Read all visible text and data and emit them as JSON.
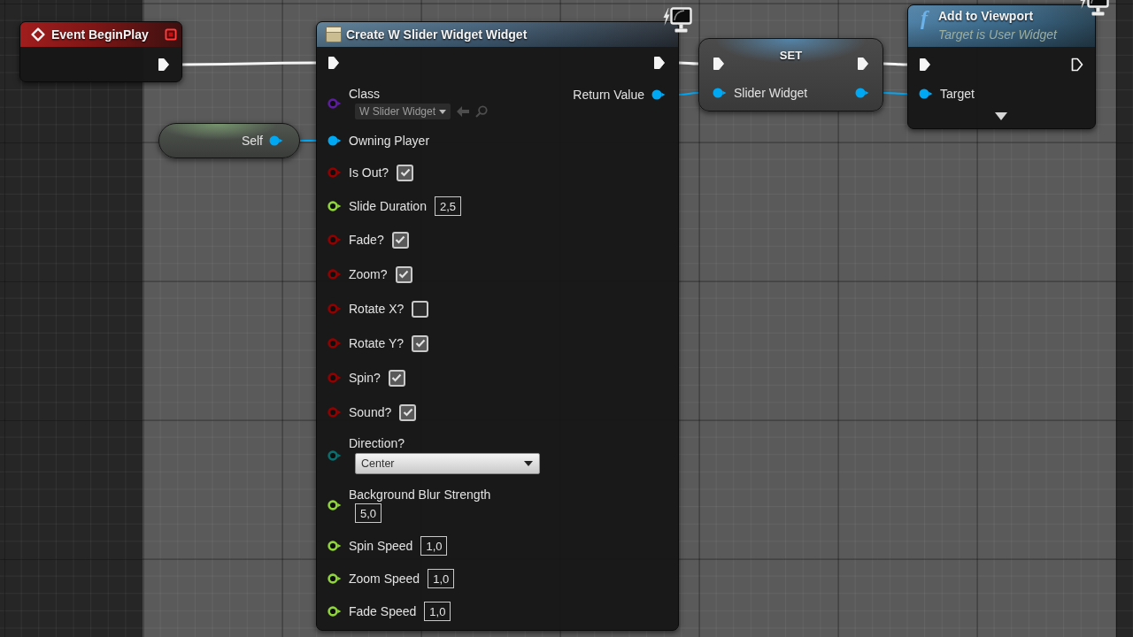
{
  "graph": {
    "nodes": [
      {
        "kind": "event",
        "title": "Event BeginPlay",
        "outputs": [
          {
            "kind": "delegate",
            "connected": false
          },
          {
            "kind": "exec",
            "connected": true
          }
        ]
      },
      {
        "kind": "self",
        "outputs": [
          {
            "kind": "object",
            "label": "Self",
            "connected": true
          }
        ]
      },
      {
        "kind": "create_widget",
        "title": "Create W Slider Widget Widget",
        "client_only": true,
        "inputs": [
          {
            "kind": "exec",
            "connected": true
          },
          {
            "kind": "class",
            "label": "Class",
            "connected": false,
            "value": "W Slider Widget"
          },
          {
            "kind": "object",
            "label": "Owning Player",
            "connected": true
          },
          {
            "kind": "bool",
            "label": "Is Out?",
            "connected": false,
            "checked": true
          },
          {
            "kind": "float",
            "label": "Slide Duration",
            "connected": false,
            "value": "2,5"
          },
          {
            "kind": "bool",
            "label": "Fade?",
            "connected": false,
            "checked": true
          },
          {
            "kind": "bool",
            "label": "Zoom?",
            "connected": false,
            "checked": true
          },
          {
            "kind": "bool",
            "label": "Rotate X?",
            "connected": false,
            "checked": false
          },
          {
            "kind": "bool",
            "label": "Rotate Y?",
            "connected": false,
            "checked": true
          },
          {
            "kind": "bool",
            "label": "Spin?",
            "connected": false,
            "checked": true
          },
          {
            "kind": "bool",
            "label": "Sound?",
            "connected": false,
            "checked": true
          },
          {
            "kind": "enum",
            "label": "Direction?",
            "connected": false,
            "value": "Center"
          },
          {
            "kind": "float",
            "label": "Background Blur Strength",
            "connected": false,
            "value": "5,0"
          },
          {
            "kind": "float",
            "label": "Spin Speed",
            "connected": false,
            "value": "1,0"
          },
          {
            "kind": "float",
            "label": "Zoom Speed",
            "connected": false,
            "value": "1,0"
          },
          {
            "kind": "float",
            "label": "Fade Speed",
            "connected": false,
            "value": "1,0"
          }
        ],
        "outputs": [
          {
            "kind": "exec",
            "connected": true
          },
          {
            "kind": "object",
            "label": "Return Value",
            "connected": true
          }
        ]
      },
      {
        "kind": "set",
        "title": "SET",
        "inputs": [
          {
            "kind": "exec",
            "connected": true
          },
          {
            "kind": "object",
            "label": "Slider Widget",
            "connected": true
          }
        ],
        "outputs": [
          {
            "kind": "exec",
            "connected": true
          },
          {
            "kind": "object",
            "connected": true
          }
        ]
      },
      {
        "kind": "function",
        "icon": "f",
        "title": "Add to Viewport",
        "subtitle": "Target is User Widget",
        "client_only": true,
        "advanced_pins_hidden": true,
        "inputs": [
          {
            "kind": "exec",
            "connected": true
          },
          {
            "kind": "object",
            "label": "Target",
            "connected": true
          }
        ],
        "outputs": [
          {
            "kind": "exec",
            "connected": false
          }
        ]
      }
    ]
  }
}
